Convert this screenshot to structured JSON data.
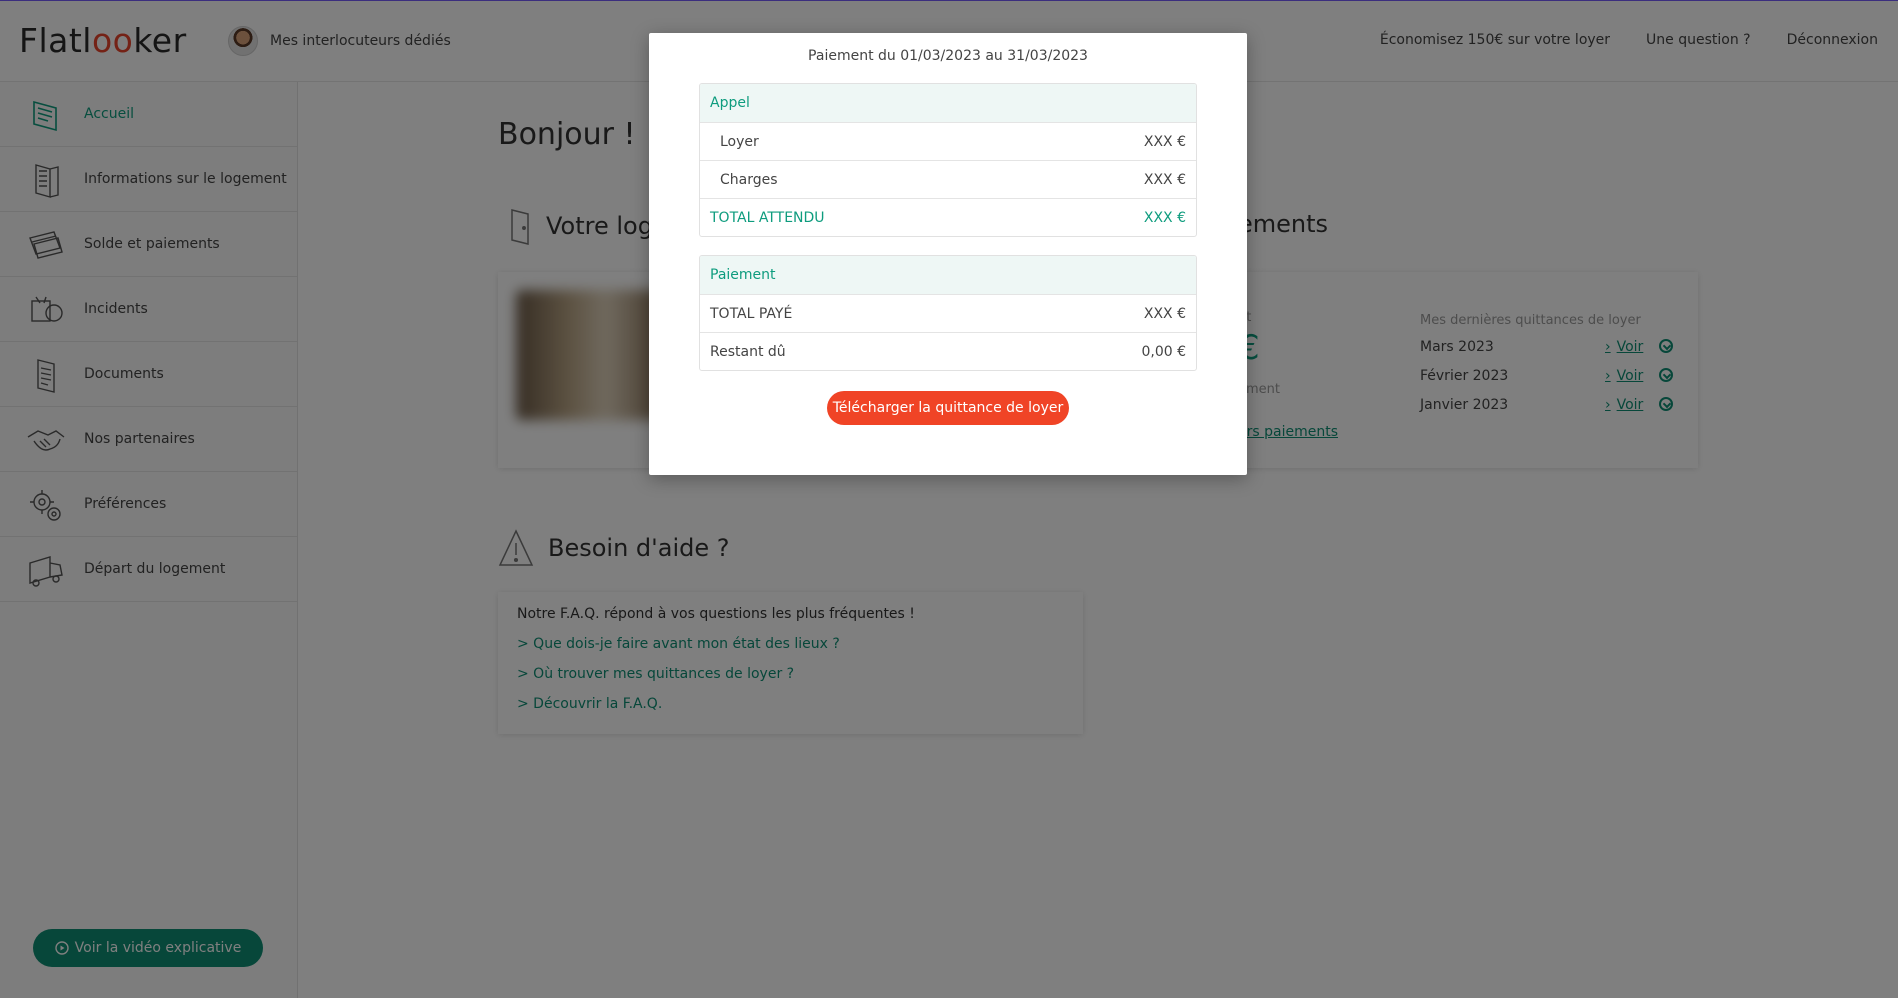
{
  "header": {
    "logo": {
      "pre": "Flatl",
      "oo": "oo",
      "post": "ker"
    },
    "contact_label": "Mes interlocuteurs dédiés",
    "links": [
      "Économisez 150€ sur votre loyer",
      "Une question ?",
      "Déconnexion"
    ]
  },
  "sidebar": {
    "items": [
      {
        "label": "Accueil",
        "icon": "home-icon",
        "active": true
      },
      {
        "label": "Informations sur le logement",
        "icon": "building-icon"
      },
      {
        "label": "Solde et paiements",
        "icon": "cards-icon"
      },
      {
        "label": "Incidents",
        "icon": "tools-icon"
      },
      {
        "label": "Documents",
        "icon": "documents-icon"
      },
      {
        "label": "Nos partenaires",
        "icon": "handshake-icon"
      },
      {
        "label": "Préférences",
        "icon": "gears-icon"
      },
      {
        "label": "Départ du logement",
        "icon": "truck-icon"
      }
    ],
    "video_button": "Voir la vidéo explicative"
  },
  "main": {
    "greeting": "Bonjour !",
    "logement_title": "Votre log",
    "paiements_title": "ements",
    "pay_amount": "€",
    "pay_label_top": "nt",
    "pay_label_mid": "ement",
    "pay_link": "ers paiements",
    "quittances": {
      "heading": "Mes dernières quittances de loyer",
      "rows": [
        {
          "month": "Mars 2023",
          "link": "Voir"
        },
        {
          "month": "Février 2023",
          "link": "Voir"
        },
        {
          "month": "Janvier 2023",
          "link": "Voir"
        }
      ]
    },
    "aide": {
      "title": "Besoin d'aide ?",
      "intro": "Notre F.A.Q. répond à vos questions les plus fréquentes !",
      "links": [
        "> Que dois-je faire avant mon état des lieux ?",
        "> Où trouver mes quittances de loyer ?",
        "> Découvrir la F.A.Q."
      ]
    }
  },
  "modal": {
    "title": "Paiement du 01/03/2023 au 31/03/2023",
    "appel": {
      "heading": "Appel",
      "rows": [
        {
          "label": "Loyer",
          "value": "XXX €"
        },
        {
          "label": "Charges",
          "value": "XXX €"
        },
        {
          "label": "TOTAL ATTENDU",
          "value": "XXX €"
        }
      ]
    },
    "paiement": {
      "heading": "Paiement",
      "rows": [
        {
          "label": "TOTAL PAYÉ",
          "value": "XXX €"
        },
        {
          "label": "Restant dû",
          "value": "0,00 €"
        }
      ]
    },
    "download_button": "Télécharger la quittance de loyer"
  },
  "colors": {
    "accent": "#0e9c7e",
    "brand_red": "#f04426",
    "video_button": "#0e8f74"
  }
}
